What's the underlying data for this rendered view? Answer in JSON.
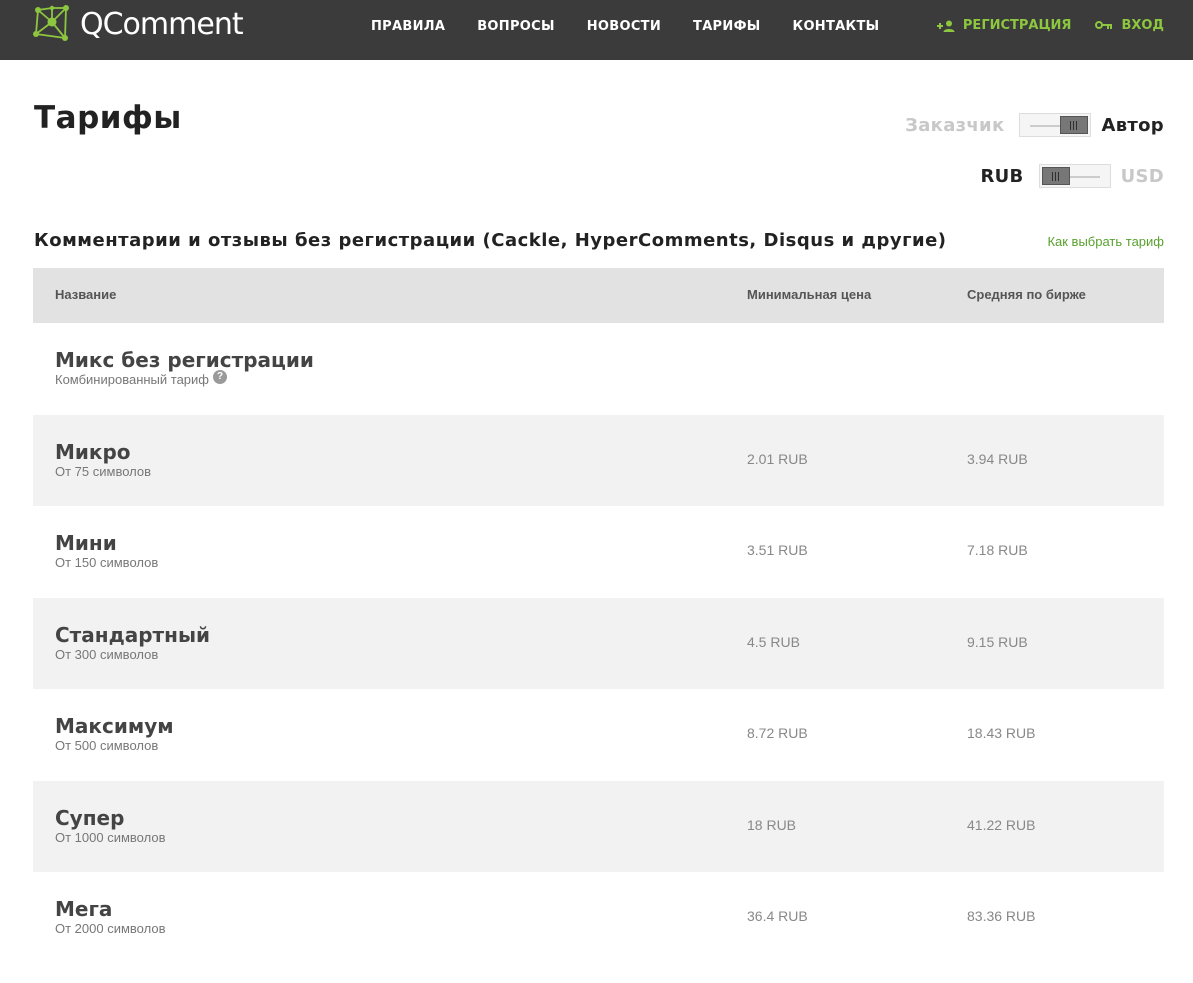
{
  "header": {
    "logo_text": "QComment",
    "nav": [
      "ПРАВИЛА",
      "ВОПРОСЫ",
      "НОВОСТИ",
      "ТАРИФЫ",
      "КОНТАКТЫ"
    ],
    "register_label": "РЕГИСТРАЦИЯ",
    "login_label": "ВХОД",
    "accent_color": "#8dc63f"
  },
  "page": {
    "title": "Тарифы"
  },
  "toggles": {
    "role": {
      "left": "Заказчик",
      "right": "Автор",
      "selected": "Автор"
    },
    "currency": {
      "left": "RUB",
      "right": "USD",
      "selected": "RUB"
    }
  },
  "section": {
    "title": "Комментарии и отзывы без регистрации (Cackle, HyperComments, Disqus и другие)",
    "help_link": "Как выбрать тариф"
  },
  "table": {
    "columns": [
      "Название",
      "Минимальная цена",
      "Средняя по бирже"
    ],
    "rows": [
      {
        "name": "Микс без регистрации",
        "sub": "Комбинированный тариф",
        "min": "",
        "avg": ""
      },
      {
        "name": "Микро",
        "sub": "От 75 символов",
        "min": "2.01 RUB",
        "avg": "3.94 RUB"
      },
      {
        "name": "Мини",
        "sub": "От 150 символов",
        "min": "3.51 RUB",
        "avg": "7.18 RUB"
      },
      {
        "name": "Стандартный",
        "sub": "От 300 символов",
        "min": "4.5 RUB",
        "avg": "9.15 RUB"
      },
      {
        "name": "Максимум",
        "sub": "От 500 символов",
        "min": "8.72 RUB",
        "avg": "18.43 RUB"
      },
      {
        "name": "Супер",
        "sub": "От 1000 символов",
        "min": "18 RUB",
        "avg": "41.22 RUB"
      },
      {
        "name": "Мега",
        "sub": "От 2000 символов",
        "min": "36.4 RUB",
        "avg": "83.36 RUB"
      }
    ]
  }
}
